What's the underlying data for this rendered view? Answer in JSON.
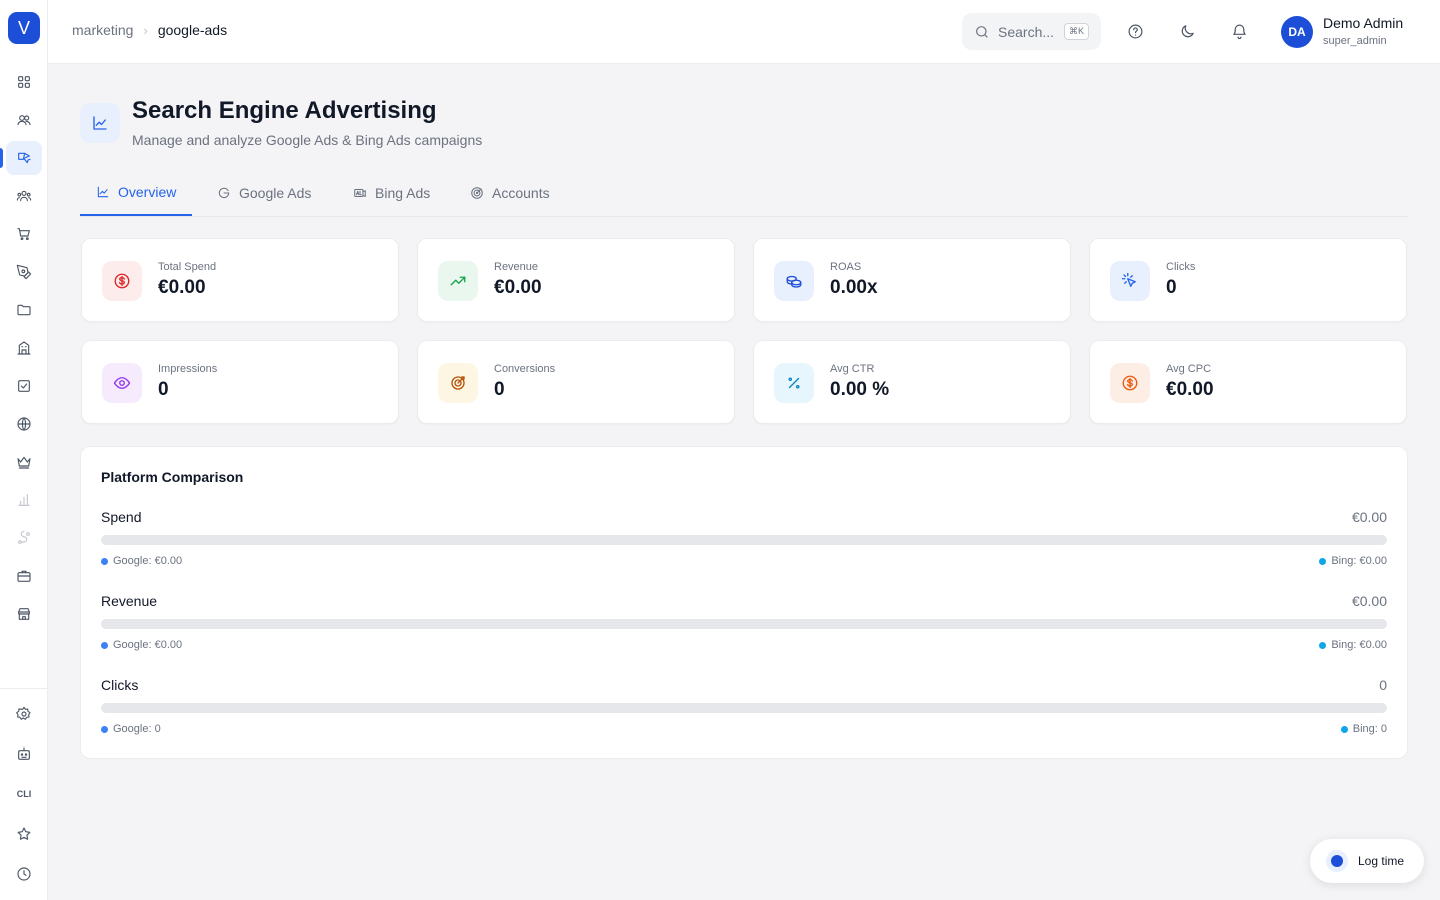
{
  "app": {
    "logo_letter": "V"
  },
  "breadcrumb": {
    "parent": "marketing",
    "current": "google-ads"
  },
  "header": {
    "search_placeholder": "Search...",
    "search_shortcut": "⌘K",
    "user": {
      "initials": "DA",
      "name": "Demo Admin",
      "role": "super_admin"
    }
  },
  "page": {
    "title": "Search Engine Advertising",
    "subtitle": "Manage and analyze Google Ads & Bing Ads campaigns"
  },
  "tabs": [
    {
      "label": "Overview",
      "icon": "chart-line-icon",
      "active": true
    },
    {
      "label": "Google Ads",
      "icon": "google-icon",
      "active": false
    },
    {
      "label": "Bing Ads",
      "icon": "ads-icon",
      "active": false
    },
    {
      "label": "Accounts",
      "icon": "target-icon",
      "active": false
    }
  ],
  "stats": [
    {
      "label": "Total Spend",
      "value": "€0.00",
      "icon": "dollar-circle-icon",
      "color": "#dc2626",
      "bg": "#fdecec"
    },
    {
      "label": "Revenue",
      "value": "€0.00",
      "icon": "trending-up-icon",
      "color": "#16a34a",
      "bg": "#e9f7ee"
    },
    {
      "label": "ROAS",
      "value": "0.00x",
      "icon": "coins-icon",
      "color": "#1d4ed8",
      "bg": "#e8effd"
    },
    {
      "label": "Clicks",
      "value": "0",
      "icon": "pointer-click-icon",
      "color": "#2563eb",
      "bg": "#e8effd"
    },
    {
      "label": "Impressions",
      "value": "0",
      "icon": "eye-icon",
      "color": "#9333ea",
      "bg": "#f5ebfd"
    },
    {
      "label": "Conversions",
      "value": "0",
      "icon": "target-icon",
      "color": "#b45309",
      "bg": "#fdf6e3"
    },
    {
      "label": "Avg CTR",
      "value": "0.00 %",
      "icon": "percent-icon",
      "color": "#0284c7",
      "bg": "#e7f5fc"
    },
    {
      "label": "Avg CPC",
      "value": "€0.00",
      "icon": "dollar-circle-icon",
      "color": "#ea580c",
      "bg": "#fdeee5"
    }
  ],
  "comparison": {
    "title": "Platform Comparison",
    "google_color": "#3b82f6",
    "bing_color": "#0ea5e9",
    "rows": [
      {
        "label": "Spend",
        "total": "€0.00",
        "google": "Google: €0.00",
        "bing": "Bing: €0.00",
        "google_share": 0
      },
      {
        "label": "Revenue",
        "total": "€0.00",
        "google": "Google: €0.00",
        "bing": "Bing: €0.00",
        "google_share": 0
      },
      {
        "label": "Clicks",
        "total": "0",
        "google": "Google: 0",
        "bing": "Bing: 0",
        "google_share": 0
      }
    ]
  },
  "sidebar": {
    "cli_label": "CLI",
    "items": [
      {
        "icon": "dashboard-icon",
        "active": false
      },
      {
        "icon": "users-icon",
        "active": false
      },
      {
        "icon": "megaphone-icon",
        "active": true
      },
      {
        "icon": "team-icon",
        "active": false
      },
      {
        "icon": "cart-icon",
        "active": false
      },
      {
        "icon": "pen-tool-icon",
        "active": false
      },
      {
        "icon": "folder-icon",
        "active": false
      },
      {
        "icon": "building-icon",
        "active": false
      },
      {
        "icon": "checkbox-icon",
        "active": false
      },
      {
        "icon": "globe-icon",
        "active": false
      },
      {
        "icon": "crown-icon",
        "active": false
      },
      {
        "icon": "bar-chart-icon",
        "active": false
      },
      {
        "icon": "route-icon",
        "active": false
      },
      {
        "icon": "briefcase-icon",
        "active": false
      },
      {
        "icon": "store-icon",
        "active": false
      }
    ],
    "bottom_items": [
      {
        "icon": "settings-icon"
      },
      {
        "icon": "bot-icon"
      },
      {
        "icon": "cli-icon"
      },
      {
        "icon": "star-icon"
      },
      {
        "icon": "clock-icon"
      }
    ]
  },
  "log_time": {
    "label": "Log time"
  }
}
